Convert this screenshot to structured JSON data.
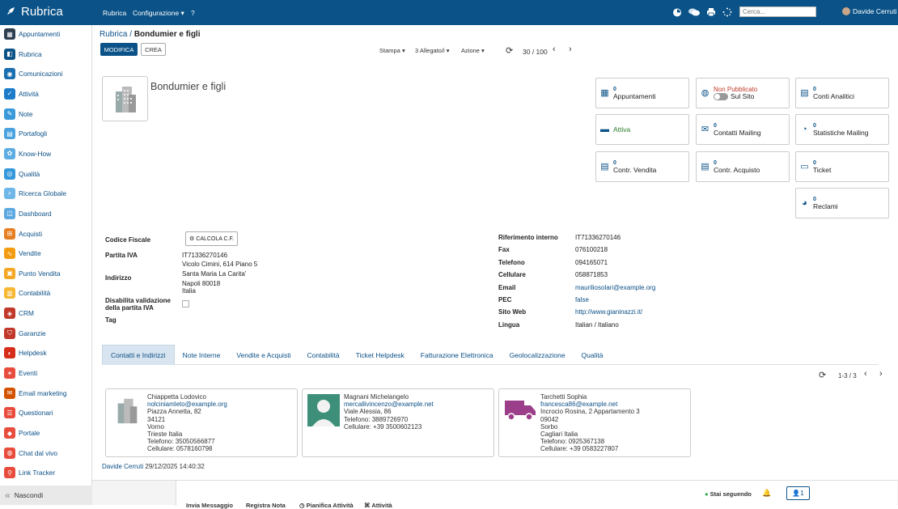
{
  "topbar": {
    "app_name": "Rubrica",
    "nav": [
      "Rubrica",
      "Configurazione ▾",
      "?"
    ],
    "search_placeholder": "Cerca...",
    "user": "Davide Cerruti"
  },
  "sidebar": {
    "items": [
      {
        "label": "Appuntamenti",
        "color": "#2c3e50",
        "icon": "calendar-icon"
      },
      {
        "label": "Rubrica",
        "color": "#0a5287",
        "icon": "address-book-icon"
      },
      {
        "label": "Comunicazioni",
        "color": "#1a6fb0",
        "icon": "chat-icon"
      },
      {
        "label": "Attività",
        "color": "#1c7cc9",
        "icon": "check-icon"
      },
      {
        "label": "Note",
        "color": "#3a9ad9",
        "icon": "note-icon"
      },
      {
        "label": "Portafogli",
        "color": "#4aa3df",
        "icon": "wallet-icon"
      },
      {
        "label": "Know-How",
        "color": "#5dade2",
        "icon": "brain-icon"
      },
      {
        "label": "Qualità",
        "color": "#3498db",
        "icon": "quality-icon"
      },
      {
        "label": "Ricerca Globale",
        "color": "#6fb7e8",
        "icon": "search-icon"
      },
      {
        "label": "Dashboard",
        "color": "#5ba7e0",
        "icon": "dashboard-icon"
      },
      {
        "label": "Acquisti",
        "color": "#e67e22",
        "icon": "cart-icon"
      },
      {
        "label": "Vendite",
        "color": "#f39c12",
        "icon": "chart-icon"
      },
      {
        "label": "Punto Vendita",
        "color": "#f5a623",
        "icon": "pos-icon"
      },
      {
        "label": "Contabilità",
        "color": "#f7b731",
        "icon": "accounting-icon"
      },
      {
        "label": "CRM",
        "color": "#c0392b",
        "icon": "crm-icon"
      },
      {
        "label": "Garanzie",
        "color": "#c0392b",
        "icon": "shield-icon"
      },
      {
        "label": "Helpdesk",
        "color": "#d62c1a",
        "icon": "headset-icon"
      },
      {
        "label": "Eventi",
        "color": "#e74c3c",
        "icon": "event-icon"
      },
      {
        "label": "Email marketing",
        "color": "#d35400",
        "icon": "mail-icon"
      },
      {
        "label": "Questionari",
        "color": "#e74c3c",
        "icon": "survey-icon"
      },
      {
        "label": "Portale",
        "color": "#e74c3c",
        "icon": "portal-icon"
      },
      {
        "label": "Chat dal vivo",
        "color": "#e74c3c",
        "icon": "chat-live-icon"
      },
      {
        "label": "Link Tracker",
        "color": "#e74c3c",
        "icon": "link-icon"
      }
    ],
    "hide_label": "Nascondi"
  },
  "breadcrumb": {
    "parent": "Rubrica",
    "sep": "/",
    "current": "Bondumier e figli"
  },
  "actions": {
    "edit": "MODIFICA",
    "create": "CREA",
    "print": "Stampa",
    "attach": "3 Allegato/i",
    "action": "Azione",
    "pager": "30 / 100"
  },
  "partner": {
    "name": "Bondumier e figli"
  },
  "smart_buttons": [
    {
      "num": "0",
      "label": "Appuntamenti",
      "icon": "calendar-icon"
    },
    {
      "num": "Non Pubblicato",
      "label": "Sul Sito",
      "icon": "globe-icon"
    },
    {
      "num": "0",
      "label": "Conti Analitici",
      "icon": "book-icon"
    },
    {
      "num": "",
      "label": "Attiva",
      "icon": "archive-icon"
    },
    {
      "num": "0",
      "label": "Contatti Mailing",
      "icon": "envelope-icon"
    },
    {
      "num": "0",
      "label": "Statistiche Mailing",
      "icon": "pie-chart-icon"
    },
    {
      "num": "0",
      "label": "Contr. Vendita",
      "icon": "contract-icon"
    },
    {
      "num": "0",
      "label": "Contr. Acquisto",
      "icon": "contract-icon"
    },
    {
      "num": "0",
      "label": "Ticket",
      "icon": "ticket-icon"
    },
    {
      "num": "0",
      "label": "Reclami",
      "icon": "comments-icon"
    }
  ],
  "left_fields": {
    "codice_fiscale_label": "Codice Fiscale",
    "calcola_btn": "CALCOLA C.F.",
    "piva_label": "Partita IVA",
    "piva": "IT71336270146",
    "indirizzo_label": "Indirizzo",
    "addr1": "Vicolo Cimini, 614 Piano 5",
    "addr2": "Santa Maria La Carita'",
    "addr3": "Napoli  80018",
    "addr4": "Italia",
    "disab_label": "Disabilita validazione della partita IVA",
    "tag_label": "Tag"
  },
  "right_fields": [
    {
      "label": "Riferimento interno",
      "value": "IT71336270146",
      "link": false
    },
    {
      "label": "Fax",
      "value": "076100218",
      "link": false
    },
    {
      "label": "Telefono",
      "value": "094165071",
      "link": false
    },
    {
      "label": "Cellulare",
      "value": "058871853",
      "link": false
    },
    {
      "label": "Email",
      "value": "mauriliosolari@example.org",
      "link": true
    },
    {
      "label": "PEC",
      "value": "false",
      "link": true
    },
    {
      "label": "Sito Web",
      "value": "http://www.gianinazzi.it/",
      "link": true
    },
    {
      "label": "Lingua",
      "value": "Italian / Italiano",
      "link": false
    }
  ],
  "tabs": [
    "Contatti e Indirizzi",
    "Note Interne",
    "Vendite e Acquisti",
    "Contabilità",
    "Ticket Helpdesk",
    "Fatturazione Elettronica",
    "Geolocalizzazione",
    "Qualità"
  ],
  "contacts_pager": "1-3 / 3",
  "contacts": [
    {
      "name": "Chiappetta Lodovico",
      "email": "nolciniamleto@example.org",
      "lines": [
        "Piazza Annetta, 82",
        "34121",
        "Vorno",
        "Trieste Italia",
        "Telefono: 35050566877",
        "Cellulare: 0578160798"
      ],
      "avatar": "building-icon"
    },
    {
      "name": "Magnani Michelangelo",
      "email": "mercallivincenzo@example.net",
      "lines": [
        "Viale Alessia, 86",
        "Telefono: 3889726970",
        "Cellulare: +39 3500602123"
      ],
      "avatar": "person-icon"
    },
    {
      "name": "Tarchetti Sophia",
      "email": "francesca86@example.net",
      "lines": [
        "Incrocio Rosina, 2 Appartamento 3",
        "09042",
        "Sorbo",
        "Cagliari Italia",
        "Telefono: 0925367138",
        "Cellulare: +39 0583227807"
      ],
      "avatar": "truck-icon"
    }
  ],
  "footer": {
    "user": "Davide Cerruti",
    "date": "29/12/2025 14:40:32"
  },
  "chatter": {
    "send": "Invia Messaggio",
    "log": "Registra Nota",
    "schedule": "Pianifica Attività",
    "activities": "Attività",
    "following": "Stai seguendo",
    "followers": "1"
  }
}
